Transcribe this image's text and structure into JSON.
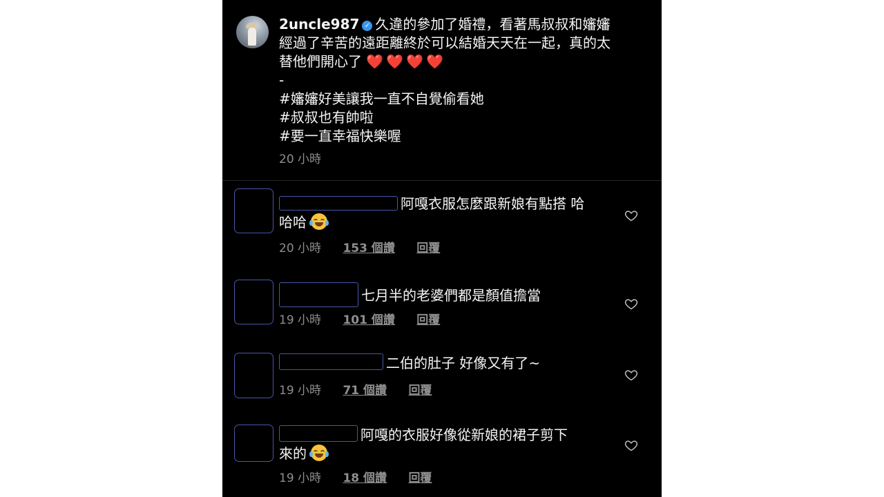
{
  "post": {
    "username": "2uncle987",
    "caption_lines": [
      "久違的參加了婚禮，看著馬叔叔和嬸嬸",
      "經過了辛苦的遠距離終於可以結婚天天在一起，真的太",
      "替他們開心了",
      "-",
      "#嬸嬸好美讓我一直不自覺偷看她",
      "#叔叔也有帥啦",
      "#要一直幸福快樂喔"
    ],
    "hearts": "❤️❤️❤️❤️",
    "time": "20 小時"
  },
  "comments": [
    {
      "text_line1": "阿嘎衣服怎麼跟新娘有點搭 哈",
      "text_line2": "哈哈",
      "time": "20 小時",
      "likes": "153 個讚",
      "reply": "回覆"
    },
    {
      "text_line1": "七月半的老婆們都是顏值擔當",
      "time": "19 小時",
      "likes": "101 個讚",
      "reply": "回覆"
    },
    {
      "text_line1": "二伯的肚子 好像又有了~",
      "time": "19 小時",
      "likes": "71 個讚",
      "reply": "回覆"
    },
    {
      "text_line1": "阿嘎的衣服好像從新娘的裙子剪下",
      "text_line2": "來的",
      "time": "19 小時",
      "likes": "18 個讚",
      "reply": "回覆"
    }
  ],
  "icons": {
    "like": "heart-outline-icon",
    "verified": "verified-badge-icon",
    "laugh_emoji": "face-with-tears-of-joy-emoji"
  },
  "colors": {
    "background": "#000000",
    "text": "#f5f5f5",
    "muted": "#8e8e8e",
    "verified": "#3897f0",
    "heart": "#ed2d4d"
  }
}
